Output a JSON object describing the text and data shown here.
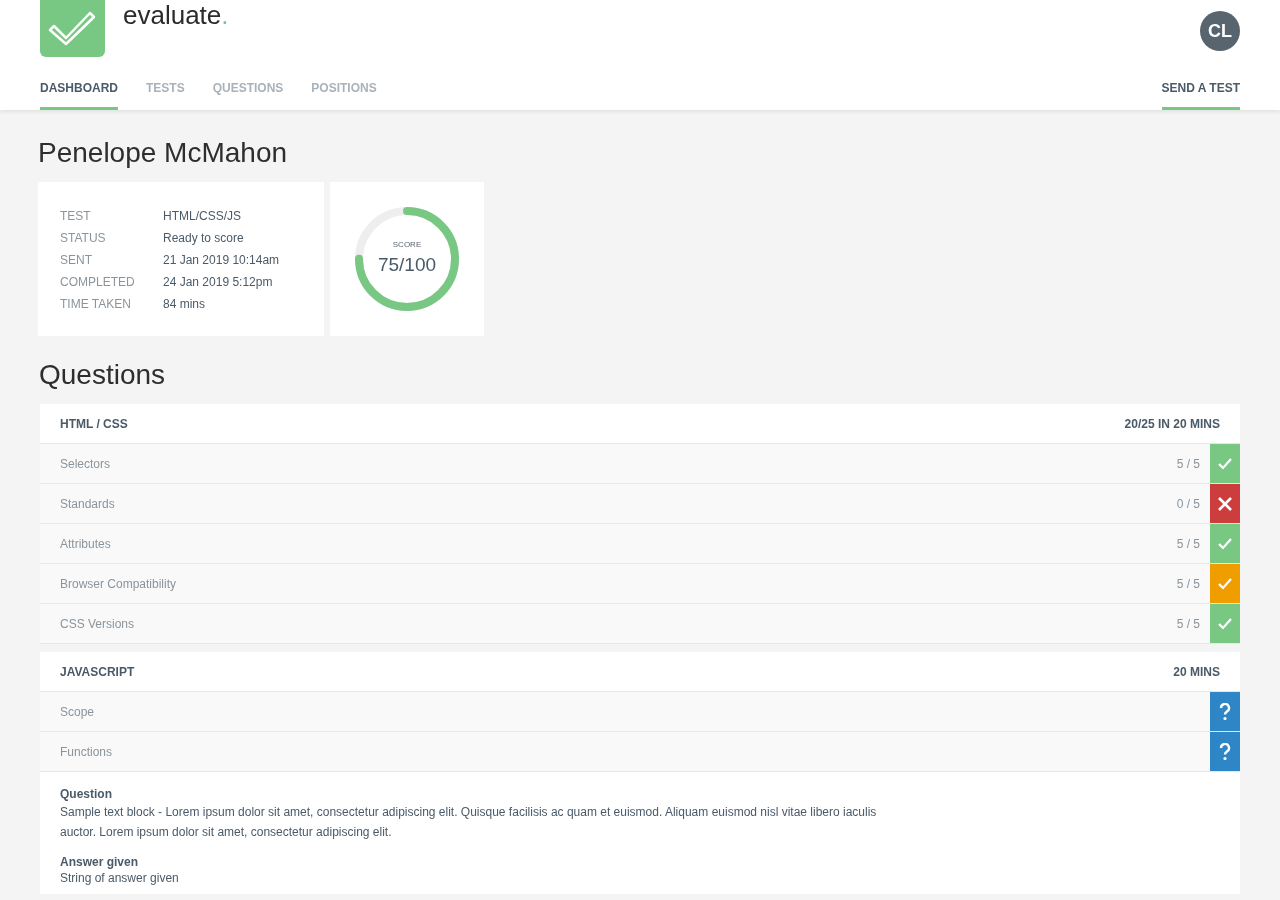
{
  "brand": {
    "name": "evaluate",
    "dot": "."
  },
  "avatar": {
    "initials": "CL"
  },
  "nav": [
    {
      "label": "DASHBOARD",
      "selected": true
    },
    {
      "label": "TESTS",
      "selected": false
    },
    {
      "label": "QUESTIONS",
      "selected": false
    },
    {
      "label": "POSITIONS",
      "selected": false
    }
  ],
  "send_test": {
    "label": "SEND A TEST"
  },
  "candidate": {
    "name": "Penelope McMahon"
  },
  "details": [
    {
      "label": "TEST",
      "value": "HTML/CSS/JS"
    },
    {
      "label": "STATUS",
      "value": "Ready to score"
    },
    {
      "label": "SENT",
      "value": "21 Jan 2019 10:14am"
    },
    {
      "label": "COMPLETED",
      "value": "24 Jan 2019 5:12pm"
    },
    {
      "label": "TIME TAKEN",
      "value": "84 mins"
    }
  ],
  "score": {
    "label": "SCORE",
    "value": "75/100",
    "level": 0.75
  },
  "questions_heading": "Questions",
  "sections": [
    {
      "title": "HTML / CSS",
      "summary": "20/25 IN 20 MINS",
      "questions": [
        {
          "name": "Selectors",
          "score": "5 / 5",
          "kind": "correct"
        },
        {
          "name": "Standards",
          "score": "0 / 5",
          "kind": "wrong"
        },
        {
          "name": "Attributes",
          "score": "5 / 5",
          "kind": "correct"
        },
        {
          "name": "Browser Compatibility",
          "score": "5 / 5",
          "kind": "partial"
        },
        {
          "name": "CSS Versions",
          "score": "5 / 5",
          "kind": "correct"
        }
      ]
    },
    {
      "title": "JAVASCRIPT",
      "summary": "20 MINS",
      "questions": [
        {
          "name": "Scope",
          "kind": "unanswered"
        },
        {
          "name": "Functions",
          "kind": "unanswered"
        }
      ]
    }
  ],
  "detail": {
    "question_label": "Question",
    "question_text": "Sample text block - Lorem ipsum dolor sit amet, consectetur adipiscing elit. Quisque facilisis ac quam et euismod. Aliquam euismod nisl vitae libero iaculis auctor. Lorem ipsum dolor sit amet, consectetur adipiscing elit.",
    "answer_label": "Answer given",
    "answer_text": "String of answer given"
  }
}
